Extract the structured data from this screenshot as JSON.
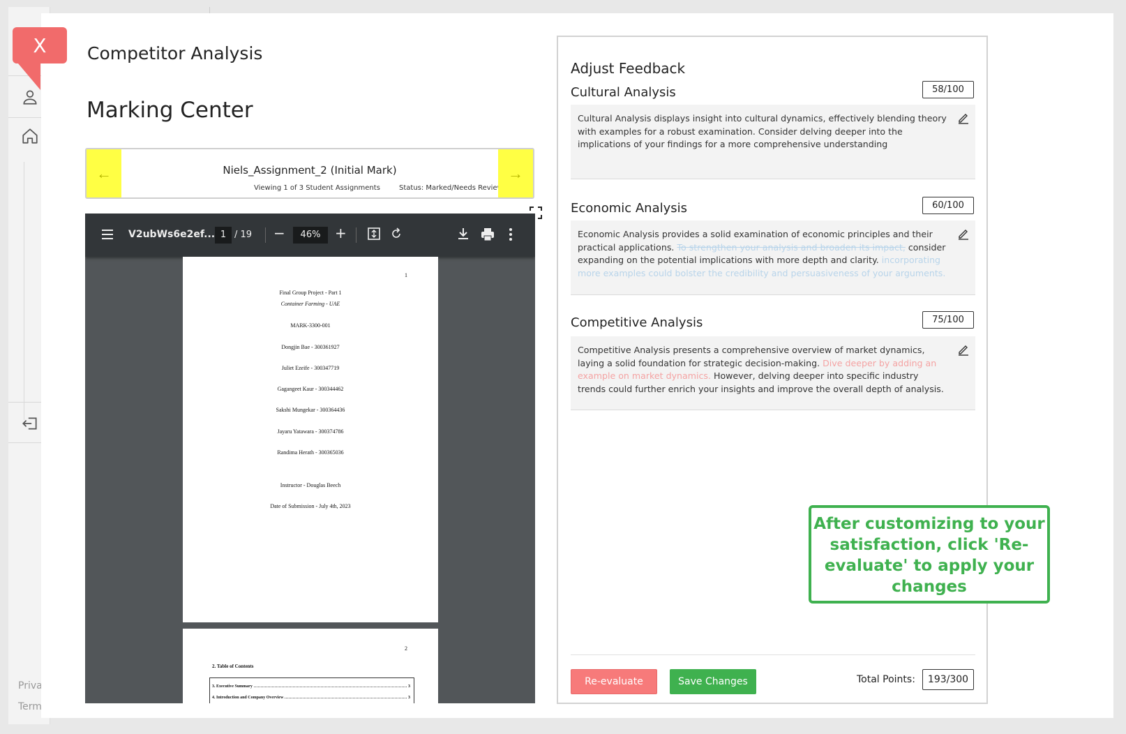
{
  "close_badge": {
    "label": "X"
  },
  "background": {
    "footer_privacy": "Priva",
    "footer_terms": "Term"
  },
  "header": {
    "course_title": "Competitor Analysis",
    "page_title": "Marking Center"
  },
  "navigator": {
    "assignment_name": "Niels_Assignment_2 (Initial Mark)",
    "viewing": "Viewing 1 of 3 Student Assignments",
    "status": "Status: Marked/Needs Review",
    "prev_label": "←",
    "next_label": "→"
  },
  "pdf_viewer": {
    "filename": "V2ubWs6e2ef...",
    "current_page": "1",
    "total_pages": "/ 19",
    "zoom": "46%",
    "minus_label": "−",
    "plus_label": "+",
    "page1": {
      "page_number": "1",
      "lines": [
        "Final Group Project - Part 1",
        "Container Farming - UAE",
        "MARK-3300-001",
        "Dongjin Bae - 300361927",
        "Juliet Ezeife - 300347719",
        "Gagangeet Kaur - 300344462",
        "Sakshi Mungekar - 300364436",
        "Jayaru Yatawara - 300374786",
        "Randima Herath - 300365036",
        "Instructor - Douglas Beech",
        "Date of Submission - July 4th, 2023"
      ]
    },
    "page2": {
      "page_number": "2",
      "toc_title": "2. Table of Contents",
      "toc_rows": [
        {
          "label": "3. Executive Summary",
          "page": "3"
        },
        {
          "label": "4. Introduction and Company Overview",
          "page": "3"
        }
      ]
    }
  },
  "feedback": {
    "title": "Adjust Feedback",
    "sections": [
      {
        "title": "Cultural Analysis",
        "score": "58/100",
        "text": "Cultural Analysis displays insight into cultural dynamics, effectively blending theory with examples for a robust examination. Consider delving deeper into the implications of your findings for a more comprehensive understanding"
      },
      {
        "title": "Economic Analysis",
        "score": "60/100",
        "text_1": "Economic Analysis provides a solid examination of economic principles and their practical applications. ",
        "strike": "To strengthen your analysis and broaden its impact,",
        "text_2": " consider expanding on the potential implications with more depth and clarity. ",
        "added": " incorporating more examples could bolster the credibility and persuasiveness of your arguments."
      },
      {
        "title": "Competitive Analysis",
        "score": "75/100",
        "text_1": "Competitive Analysis presents a comprehensive overview of market dynamics, laying a solid foundation for strategic decision-making. ",
        "added": "Dive deeper by adding an example on market dynamics.",
        "text_2": " However, delving deeper into specific industry trends could further enrich your insights and improve the overall depth of analysis."
      }
    ],
    "reevaluate_label": "Re-evaluate",
    "save_label": "Save Changes",
    "total_label": "Total Points:",
    "total_value": "193/300"
  },
  "tooltip": {
    "text": "After customizing to your satisfaction, click 'Re-evaluate' to apply your changes"
  },
  "colors": {
    "accent_green": "#3fb14f",
    "accent_red": "#f77a7a",
    "nav_yellow": "#ffff44"
  }
}
